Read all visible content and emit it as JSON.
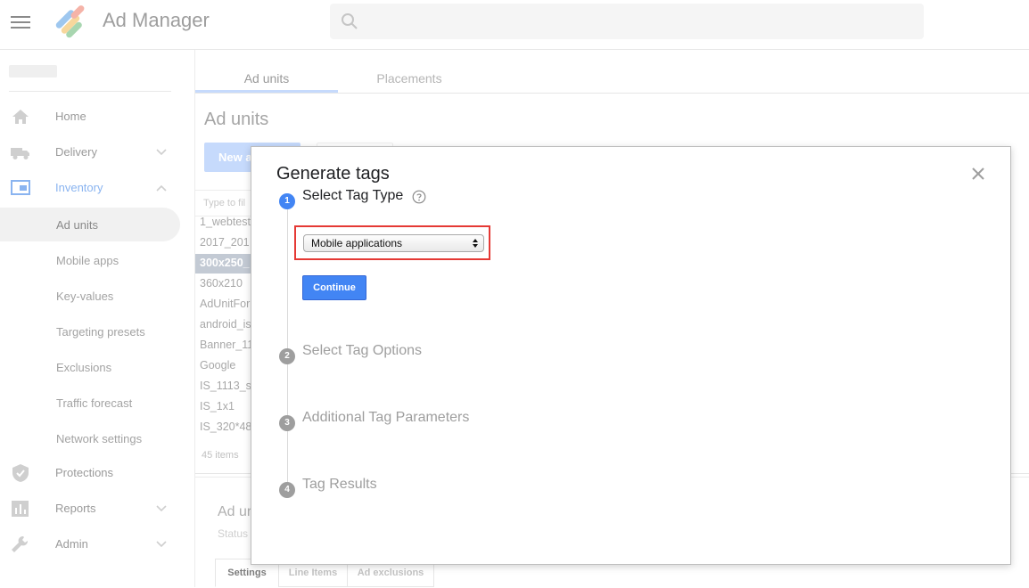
{
  "app": {
    "brand": "Ad Manager"
  },
  "sidebar": {
    "nav": [
      {
        "label": "Home",
        "icon": "home-icon"
      },
      {
        "label": "Delivery",
        "icon": "truck-icon"
      },
      {
        "label": "Inventory",
        "icon": "inventory-icon"
      }
    ],
    "inventory_sub": [
      "Ad units",
      "Mobile apps",
      "Key-values",
      "Targeting presets",
      "Exclusions",
      "Traffic forecast",
      "Network settings"
    ],
    "nav_bottom": [
      {
        "label": "Protections",
        "icon": "shield-icon"
      },
      {
        "label": "Reports",
        "icon": "bar-chart-icon"
      },
      {
        "label": "Admin",
        "icon": "wrench-icon"
      }
    ]
  },
  "main": {
    "tabs": [
      "Ad units",
      "Placements"
    ],
    "title": "Ad units",
    "new_button": "New a",
    "filter_placeholder": "Type to fil",
    "rows": [
      "1_webtest",
      "2017_201",
      "300x250_",
      "360x210",
      "AdUnitFor",
      "android_is",
      "Banner_11",
      "Google",
      "IS_1113_s",
      "IS_1x1",
      "IS_320*48"
    ],
    "items_count": "45 items",
    "detail_title": "Ad ur",
    "detail_status": "Status",
    "subtabs": [
      "Settings",
      "Line Items",
      "Ad exclusions"
    ]
  },
  "dialog": {
    "title": "Generate tags",
    "steps": [
      {
        "num": "1",
        "label": "Select Tag Type"
      },
      {
        "num": "2",
        "label": "Select Tag Options"
      },
      {
        "num": "3",
        "label": "Additional Tag Parameters"
      },
      {
        "num": "4",
        "label": "Tag Results"
      }
    ],
    "select_value": "Mobile applications",
    "continue_label": "Continue"
  }
}
